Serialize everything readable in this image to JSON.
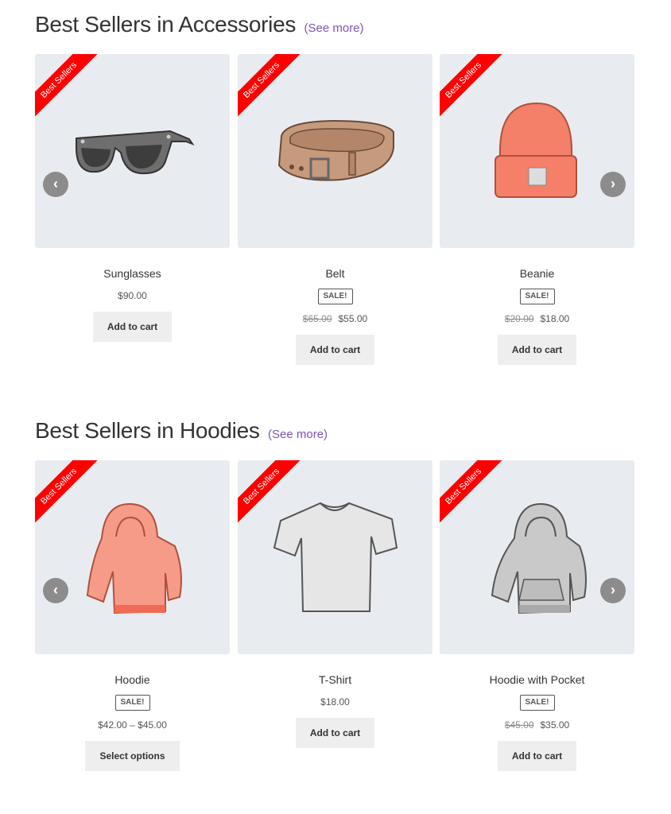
{
  "sections": [
    {
      "title": "Best Sellers in Accessories",
      "see_more": "(See more)",
      "products": [
        {
          "ribbon": "Best Sellers",
          "name": "Sunglasses",
          "price": "$90.00",
          "button": "Add to cart"
        },
        {
          "ribbon": "Best Sellers",
          "name": "Belt",
          "sale_badge": "SALE!",
          "old_price": "$65.00",
          "price": "$55.00",
          "button": "Add to cart"
        },
        {
          "ribbon": "Best Sellers",
          "name": "Beanie",
          "sale_badge": "SALE!",
          "old_price": "$20.00",
          "price": "$18.00",
          "button": "Add to cart"
        }
      ]
    },
    {
      "title": "Best Sellers in Hoodies",
      "see_more": "(See more)",
      "products": [
        {
          "ribbon": "Best Sellers",
          "name": "Hoodie",
          "sale_badge": "SALE!",
          "price": "$42.00 – $45.00",
          "button": "Select options"
        },
        {
          "ribbon": "Best Sellers",
          "name": "T-Shirt",
          "price": "$18.00",
          "button": "Add to cart"
        },
        {
          "ribbon": "Best Sellers",
          "name": "Hoodie with Pocket",
          "sale_badge": "SALE!",
          "old_price": "$45.00",
          "price": "$35.00",
          "button": "Add to cart"
        }
      ]
    }
  ],
  "carousel": {
    "prev_icon": "chevron-left-icon",
    "next_icon": "chevron-right-icon"
  },
  "colors": {
    "accent": "#7f54b3",
    "ribbon": "#ff0000",
    "card_bg": "#e8ecf1",
    "button_bg": "#eeeeee",
    "arrow_bg": "#8c8c8c"
  }
}
